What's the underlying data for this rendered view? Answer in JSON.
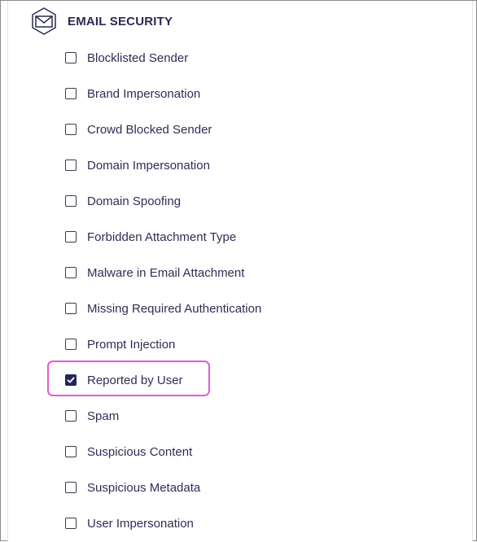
{
  "section": {
    "title": "EMAIL SECURITY",
    "icon": "envelope-hexagon-icon"
  },
  "options": [
    {
      "label": "Blocklisted Sender",
      "checked": false
    },
    {
      "label": "Brand Impersonation",
      "checked": false
    },
    {
      "label": "Crowd Blocked Sender",
      "checked": false
    },
    {
      "label": "Domain Impersonation",
      "checked": false
    },
    {
      "label": "Domain Spoofing",
      "checked": false
    },
    {
      "label": "Forbidden Attachment Type",
      "checked": false
    },
    {
      "label": "Malware in Email Attachment",
      "checked": false
    },
    {
      "label": "Missing Required Authentication",
      "checked": false
    },
    {
      "label": "Prompt Injection",
      "checked": false
    },
    {
      "label": "Reported by User",
      "checked": true
    },
    {
      "label": "Spam",
      "checked": false
    },
    {
      "label": "Suspicious Content",
      "checked": false
    },
    {
      "label": "Suspicious Metadata",
      "checked": false
    },
    {
      "label": "User Impersonation",
      "checked": false
    }
  ],
  "colors": {
    "text": "#2f2e55",
    "checkbox_checked": "#25235a",
    "highlight": "#e45ad2"
  }
}
